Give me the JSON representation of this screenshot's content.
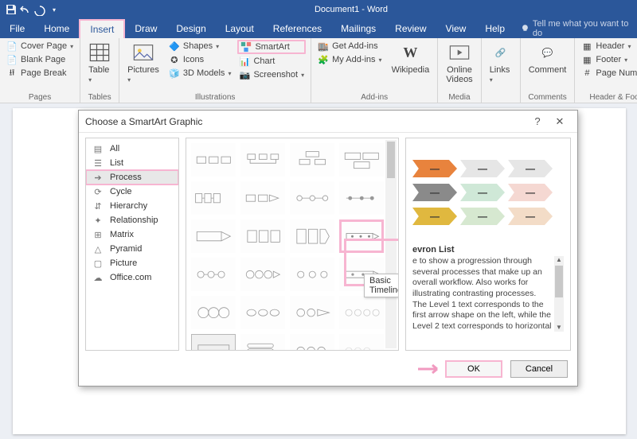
{
  "app": {
    "title": "Document1 - Word"
  },
  "menus": {
    "file": "File",
    "home": "Home",
    "insert": "Insert",
    "draw": "Draw",
    "design": "Design",
    "layout": "Layout",
    "references": "References",
    "mailings": "Mailings",
    "review": "Review",
    "view": "View",
    "help": "Help",
    "tellme": "Tell me what you want to do"
  },
  "ribbon": {
    "pages": {
      "cover": "Cover Page",
      "blank": "Blank Page",
      "break": "Page Break",
      "label": "Pages"
    },
    "tables": {
      "btn": "Table",
      "label": "Tables"
    },
    "illus": {
      "pictures": "Pictures",
      "shapes": "Shapes",
      "icons": "Icons",
      "models": "3D Models",
      "smartart": "SmartArt",
      "chart": "Chart",
      "screenshot": "Screenshot",
      "label": "Illustrations"
    },
    "addins": {
      "get": "Get Add-ins",
      "my": "My Add-ins",
      "wiki": "Wikipedia",
      "label": "Add-ins"
    },
    "media": {
      "video": "Online Videos",
      "label": "Media"
    },
    "links": {
      "btn": "Links",
      "label": ""
    },
    "comments": {
      "btn": "Comment",
      "label": "Comments"
    },
    "hf": {
      "header": "Header",
      "footer": "Footer",
      "pnum": "Page Number",
      "label": "Header & Footer"
    }
  },
  "dialog": {
    "title": "Choose a SmartArt Graphic",
    "help": "?",
    "categories": [
      "All",
      "List",
      "Process",
      "Cycle",
      "Hierarchy",
      "Relationship",
      "Matrix",
      "Pyramid",
      "Picture",
      "Office.com"
    ],
    "selected_cat_index": 2,
    "tooltip": "Basic Timeline",
    "preview": {
      "title_fragment": "evron List",
      "desc": "e to show a progression through several processes that make up an overall workflow. Also works for illustrating contrasting processes. The Level 1 text corresponds to the first arrow shape on the left, while the Level 2 text corresponds to horizontal"
    },
    "ok": "OK",
    "cancel": "Cancel"
  }
}
